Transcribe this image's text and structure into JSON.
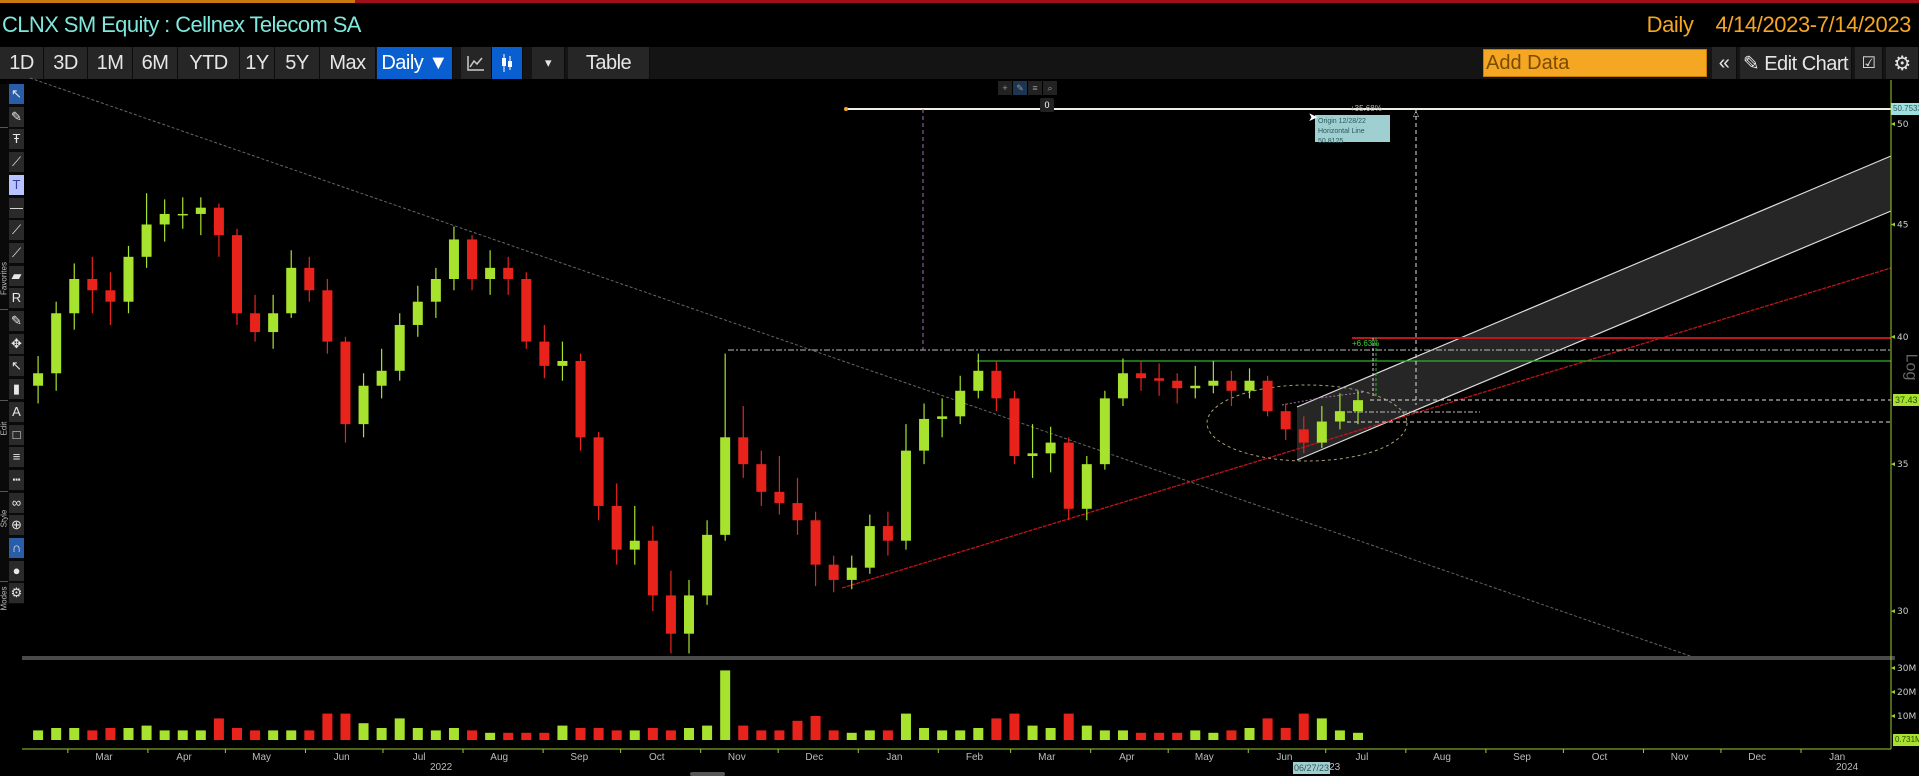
{
  "header": {
    "title": "CLNX SM Equity : Cellnex Telecom SA",
    "frequency": "Daily",
    "date_range": "4/14/2023-7/14/2023"
  },
  "toolbar": {
    "ranges": [
      "1D",
      "3D",
      "1M",
      "6M",
      "YTD",
      "1Y",
      "5Y",
      "Max"
    ],
    "frequency_label": "Daily ▼",
    "line_chart_icon": "line-chart-icon",
    "candle_icon": "candlestick-icon",
    "dropdown": "▾",
    "table_label": "Table",
    "add_data_placeholder": "Add Data",
    "collapse": "«",
    "edit_chart_label": "✎ Edit Chart",
    "edit_icon": "☑",
    "settings": "⚙"
  },
  "left_tools": {
    "sections": [
      "Favorites",
      "Edit",
      "Style",
      "Modes"
    ],
    "items": [
      {
        "name": "pointer-icon",
        "glyph": "↖",
        "state": "selected"
      },
      {
        "name": "pen-icon",
        "glyph": "✎"
      },
      {
        "name": "fibonacci-icon",
        "glyph": "Ŧ"
      },
      {
        "name": "trend-line-icon",
        "glyph": "⟋"
      },
      {
        "name": "text-icon",
        "glyph": "T",
        "state": "highlighted"
      },
      {
        "name": "horizontal-line-icon",
        "glyph": "—"
      },
      {
        "name": "ray-icon",
        "glyph": "⟋"
      },
      {
        "name": "extended-line-icon",
        "glyph": "⟋"
      },
      {
        "name": "channel-icon",
        "glyph": "▰"
      },
      {
        "name": "regression-icon",
        "glyph": "R"
      },
      {
        "name": "pencil-icon",
        "glyph": "✎"
      },
      {
        "name": "move-icon",
        "glyph": "✥"
      },
      {
        "name": "select-add-icon",
        "glyph": "↖"
      },
      {
        "name": "trash-icon",
        "glyph": "▮"
      },
      {
        "name": "font-icon",
        "glyph": "A"
      },
      {
        "name": "fill-icon",
        "glyph": "□"
      },
      {
        "name": "line-weight-icon",
        "glyph": "≡"
      },
      {
        "name": "line-style-icon",
        "glyph": "┅"
      },
      {
        "name": "link-icon",
        "glyph": "∞"
      },
      {
        "name": "lock-add-icon",
        "glyph": "⊕"
      },
      {
        "name": "magnet-icon",
        "glyph": "∩",
        "state": "selected"
      },
      {
        "name": "colors-icon",
        "glyph": "●"
      },
      {
        "name": "gear-icon",
        "glyph": "⚙"
      }
    ]
  },
  "annotations": {
    "mini_toolbar": [
      "+",
      "✎",
      "≡",
      "⌕"
    ],
    "handle": "0",
    "tooltip": [
      "Origin 12/28/22",
      "Horizontal Line 50.8125"
    ],
    "pct_top": "+35.68%",
    "pct_mid": "+6.63%",
    "hline_value": "50.7533",
    "last_price": "37.43",
    "last_volume": "0.731M",
    "cursor_date": "06/27/23"
  },
  "colors": {
    "up": "#a6e22e",
    "down": "#e8231b",
    "axis": "#9acd32",
    "background": "#000000"
  },
  "chart_data": {
    "type": "candlestick",
    "scale": "log",
    "price_ticks": [
      30,
      35,
      40,
      45,
      50
    ],
    "volume_ticks": [
      "10M",
      "20M",
      "30M"
    ],
    "volume_tick_values": [
      10,
      20,
      30
    ],
    "axis_title": "Log",
    "months": [
      "Mar",
      "Apr",
      "May",
      "Jun",
      "Jul",
      "Aug",
      "Sep",
      "Oct",
      "Nov",
      "Dec",
      "Jan",
      "Feb",
      "Mar",
      "Apr",
      "May",
      "Jun",
      "Jul",
      "Aug",
      "Sep",
      "Oct",
      "Nov",
      "Dec",
      "Jan"
    ],
    "years": [
      "2022",
      "2023",
      "2024"
    ],
    "columns": [
      "week",
      "open",
      "high",
      "low",
      "close",
      "volume_m"
    ],
    "candles": [
      [
        "2022-02-14",
        38,
        39.2,
        37.3,
        38.5,
        4
      ],
      [
        "2022-02-21",
        38.5,
        41.5,
        37.8,
        41,
        5
      ],
      [
        "2022-02-28",
        41,
        43.2,
        40.3,
        42.5,
        5
      ],
      [
        "2022-03-07",
        42.5,
        43.5,
        41,
        42,
        4
      ],
      [
        "2022-03-14",
        42,
        42.8,
        40.5,
        41.5,
        5
      ],
      [
        "2022-03-21",
        41.5,
        44,
        41,
        43.5,
        5
      ],
      [
        "2022-03-28",
        43.5,
        46.5,
        43,
        45,
        6
      ],
      [
        "2022-04-04",
        45,
        46.2,
        44.2,
        45.5,
        4
      ],
      [
        "2022-04-11",
        45.5,
        46.3,
        44.8,
        45.5,
        4
      ],
      [
        "2022-04-18",
        45.5,
        46.3,
        44.5,
        45.8,
        4
      ],
      [
        "2022-04-25",
        45.8,
        46,
        43.5,
        44.5,
        9
      ],
      [
        "2022-05-02",
        44.5,
        44.8,
        40.5,
        41,
        5
      ],
      [
        "2022-05-09",
        41,
        41.8,
        39.8,
        40.2,
        4
      ],
      [
        "2022-05-16",
        40.2,
        41.8,
        39.5,
        41,
        4
      ],
      [
        "2022-05-23",
        41,
        43.8,
        40.8,
        43,
        4
      ],
      [
        "2022-05-30",
        43,
        43.5,
        41.5,
        42,
        4
      ],
      [
        "2022-06-06",
        42,
        42.5,
        39.3,
        39.8,
        11
      ],
      [
        "2022-06-13",
        39.8,
        40,
        35.8,
        36.5,
        11
      ],
      [
        "2022-06-20",
        36.5,
        38.5,
        36,
        38,
        7
      ],
      [
        "2022-06-27",
        38,
        39.5,
        37.5,
        38.6,
        5
      ],
      [
        "2022-07-04",
        38.6,
        41,
        38.2,
        40.5,
        9
      ],
      [
        "2022-07-11",
        40.5,
        42.2,
        40,
        41.5,
        5
      ],
      [
        "2022-07-18",
        41.5,
        43,
        40.8,
        42.5,
        4
      ],
      [
        "2022-07-25",
        42.5,
        44.9,
        42,
        44.3,
        5
      ],
      [
        "2022-08-01",
        44.3,
        44.5,
        42,
        42.5,
        4
      ],
      [
        "2022-08-08",
        42.5,
        43.8,
        41.8,
        43,
        3
      ],
      [
        "2022-08-15",
        43,
        43.5,
        41.8,
        42.5,
        3
      ],
      [
        "2022-08-22",
        42.5,
        42.8,
        39.5,
        39.8,
        3
      ],
      [
        "2022-08-29",
        39.8,
        40.5,
        38.3,
        38.8,
        3
      ],
      [
        "2022-09-05",
        38.8,
        39.8,
        38.2,
        39,
        6
      ],
      [
        "2022-09-12",
        39,
        39.3,
        35.5,
        36,
        5
      ],
      [
        "2022-09-19",
        36,
        36.2,
        33,
        33.5,
        5
      ],
      [
        "2022-09-26",
        33.5,
        34.3,
        31.5,
        32,
        4
      ],
      [
        "2022-10-03",
        32,
        33.5,
        31.5,
        32.3,
        4
      ],
      [
        "2022-10-10",
        32.3,
        32.8,
        30,
        30.5,
        5
      ],
      [
        "2022-10-17",
        30.5,
        31.3,
        28.7,
        29.3,
        4
      ],
      [
        "2022-10-24",
        29.3,
        31,
        28.7,
        30.5,
        5
      ],
      [
        "2022-10-31",
        30.5,
        33,
        30.2,
        32.5,
        6
      ],
      [
        "2022-11-07",
        32.5,
        39.3,
        32.3,
        36,
        29
      ],
      [
        "2022-11-14",
        36,
        37.2,
        34.5,
        35,
        6
      ],
      [
        "2022-11-21",
        35,
        35.5,
        33.5,
        34,
        4
      ],
      [
        "2022-11-28",
        34,
        35.3,
        33.2,
        33.6,
        4
      ],
      [
        "2022-12-05",
        33.6,
        34.5,
        32.5,
        33,
        8
      ],
      [
        "2022-12-12",
        33,
        33.3,
        30.8,
        31.5,
        10
      ],
      [
        "2022-12-19",
        31.5,
        31.8,
        30.6,
        31,
        4
      ],
      [
        "2022-12-26",
        31,
        31.8,
        30.7,
        31.4,
        3
      ],
      [
        "2023-01-02",
        31.4,
        33.2,
        31.2,
        32.8,
        4
      ],
      [
        "2023-01-09",
        32.8,
        33.3,
        31.8,
        32.3,
        4
      ],
      [
        "2023-01-16",
        32.3,
        36.5,
        32,
        35.5,
        11
      ],
      [
        "2023-01-23",
        35.5,
        37.3,
        35,
        36.7,
        5
      ],
      [
        "2023-01-30",
        36.7,
        37.5,
        36,
        36.8,
        4
      ],
      [
        "2023-02-06",
        36.8,
        38.4,
        36.5,
        37.8,
        4
      ],
      [
        "2023-02-13",
        37.8,
        39.3,
        37.5,
        38.6,
        5
      ],
      [
        "2023-02-20",
        38.6,
        39,
        37,
        37.5,
        9
      ],
      [
        "2023-02-27",
        37.5,
        37.8,
        35,
        35.3,
        11
      ],
      [
        "2023-03-06",
        35.3,
        36.5,
        34.5,
        35.4,
        6
      ],
      [
        "2023-03-13",
        35.4,
        36.4,
        34.7,
        35.8,
        5
      ],
      [
        "2023-03-20",
        35.8,
        36,
        33,
        33.4,
        11
      ],
      [
        "2023-03-27",
        33.4,
        35.3,
        33,
        35,
        6
      ],
      [
        "2023-04-03",
        35,
        37.8,
        34.8,
        37.5,
        4
      ],
      [
        "2023-04-10",
        37.5,
        39.1,
        37.2,
        38.5,
        4
      ],
      [
        "2023-04-17",
        38.5,
        39,
        37.8,
        38.3,
        3
      ],
      [
        "2023-04-24",
        38.3,
        38.9,
        37.6,
        38.2,
        3
      ],
      [
        "2023-05-01",
        38.2,
        38.5,
        37.3,
        37.9,
        3
      ],
      [
        "2023-05-08",
        37.9,
        38.8,
        37.5,
        38,
        4
      ],
      [
        "2023-05-15",
        38,
        39,
        37.7,
        38.2,
        3
      ],
      [
        "2023-05-22",
        38.2,
        38.6,
        37.2,
        37.8,
        4
      ],
      [
        "2023-05-29",
        37.8,
        38.7,
        37.5,
        38.2,
        5
      ],
      [
        "2023-06-05",
        38.2,
        38.4,
        36.8,
        37,
        9
      ],
      [
        "2023-06-12",
        37,
        37.3,
        35.9,
        36.3,
        5
      ],
      [
        "2023-06-19",
        36.3,
        36.8,
        35.4,
        35.8,
        11
      ],
      [
        "2023-06-26",
        35.8,
        37.2,
        35.6,
        36.6,
        9
      ],
      [
        "2023-07-03",
        36.6,
        37.7,
        36.3,
        37,
        4
      ],
      [
        "2023-07-10",
        37,
        37.8,
        36.5,
        37.43,
        3
      ]
    ]
  }
}
